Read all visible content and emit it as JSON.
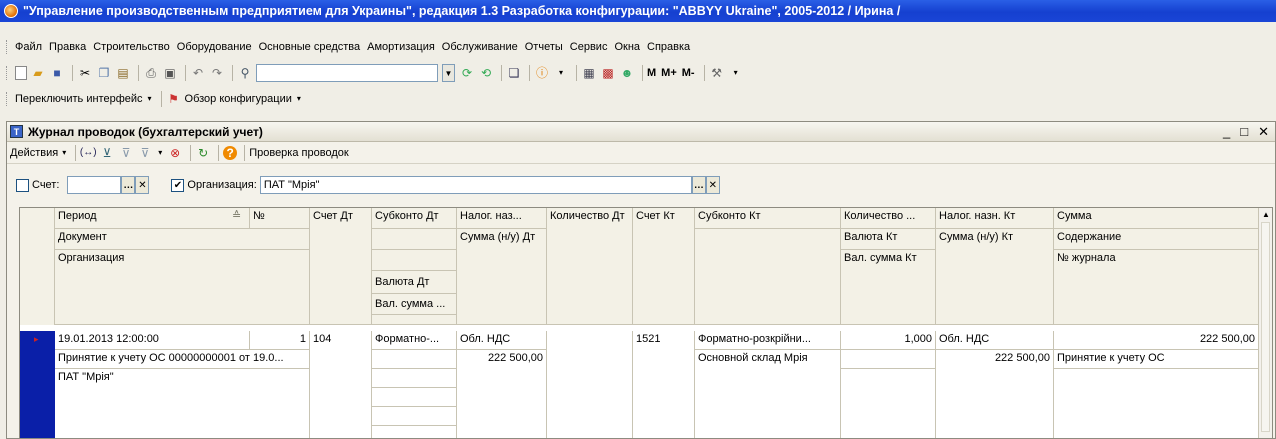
{
  "window": {
    "title": "\"Управление производственным предприятием для Украины\", редакция 1.3 Разработка конфигурации: \"ABBYY Ukraine\", 2005-2012 / Ирина /"
  },
  "menu": {
    "items": [
      "Файл",
      "Правка",
      "Строительство",
      "Оборудование",
      "Основные средства",
      "Амортизация",
      "Обслуживание",
      "Отчеты",
      "Сервис",
      "Окна",
      "Справка"
    ]
  },
  "toolbar": {
    "m_label": "M",
    "mplus_label": "M+",
    "mminus_label": "M-",
    "search_value": ""
  },
  "toolbar2": {
    "switch_interface": "Переключить интерфейс",
    "overview": "Обзор конфигурации"
  },
  "doc": {
    "title": "Журнал проводок (бухгалтерский учет)",
    "actions_label": "Действия",
    "check_label": "Проверка проводок",
    "filter": {
      "account_label": "Счет:",
      "account_value": "",
      "account_checked": false,
      "org_label": "Организация:",
      "org_value": "ПАТ \"Мрія\"",
      "org_checked": true
    }
  },
  "table": {
    "headers": {
      "period": "Период",
      "num": "№",
      "document": "Документ",
      "organization": "Организация",
      "account_dt": "Счет Дт",
      "subconto_dt": "Субконто Дт",
      "currency_dt": "Валюта Дт",
      "cur_sum_dt": "Вал. сумма ...",
      "tax_dt": "Налог. наз...",
      "sum_tax_dt": "Сумма (н/у) Дт",
      "qty_dt": "Количество Дт",
      "account_kt": "Счет Кт",
      "subconto_kt": "Субконто Кт",
      "qty_kt": "Количество ...",
      "currency_kt": "Валюта Кт",
      "cur_sum_kt": "Вал. сумма Кт",
      "tax_kt": "Налог. назн. Кт",
      "sum_tax_kt": "Сумма (н/у) Кт",
      "sum": "Сумма",
      "content": "Содержание",
      "journal_no": "№ журнала"
    },
    "row": {
      "period": "19.01.2013 12:00:00",
      "num": "1",
      "document": "Принятие к учету ОС 00000000001 от 19.0...",
      "organization": "ПАТ \"Мрія\"",
      "account_dt": "104",
      "subconto_dt": "Форматно-...",
      "tax_dt": "Обл. НДС",
      "sum_tax_dt": "222 500,00",
      "account_kt": "1521",
      "subconto_kt": "Форматно-розкрійни...",
      "subconto_kt2": "Основной склад Мрія",
      "qty_kt": "1,000",
      "tax_kt": "Обл. НДС",
      "sum_tax_kt": "222 500,00",
      "sum": "222 500,00",
      "content": "Принятие к учету ОС"
    }
  }
}
